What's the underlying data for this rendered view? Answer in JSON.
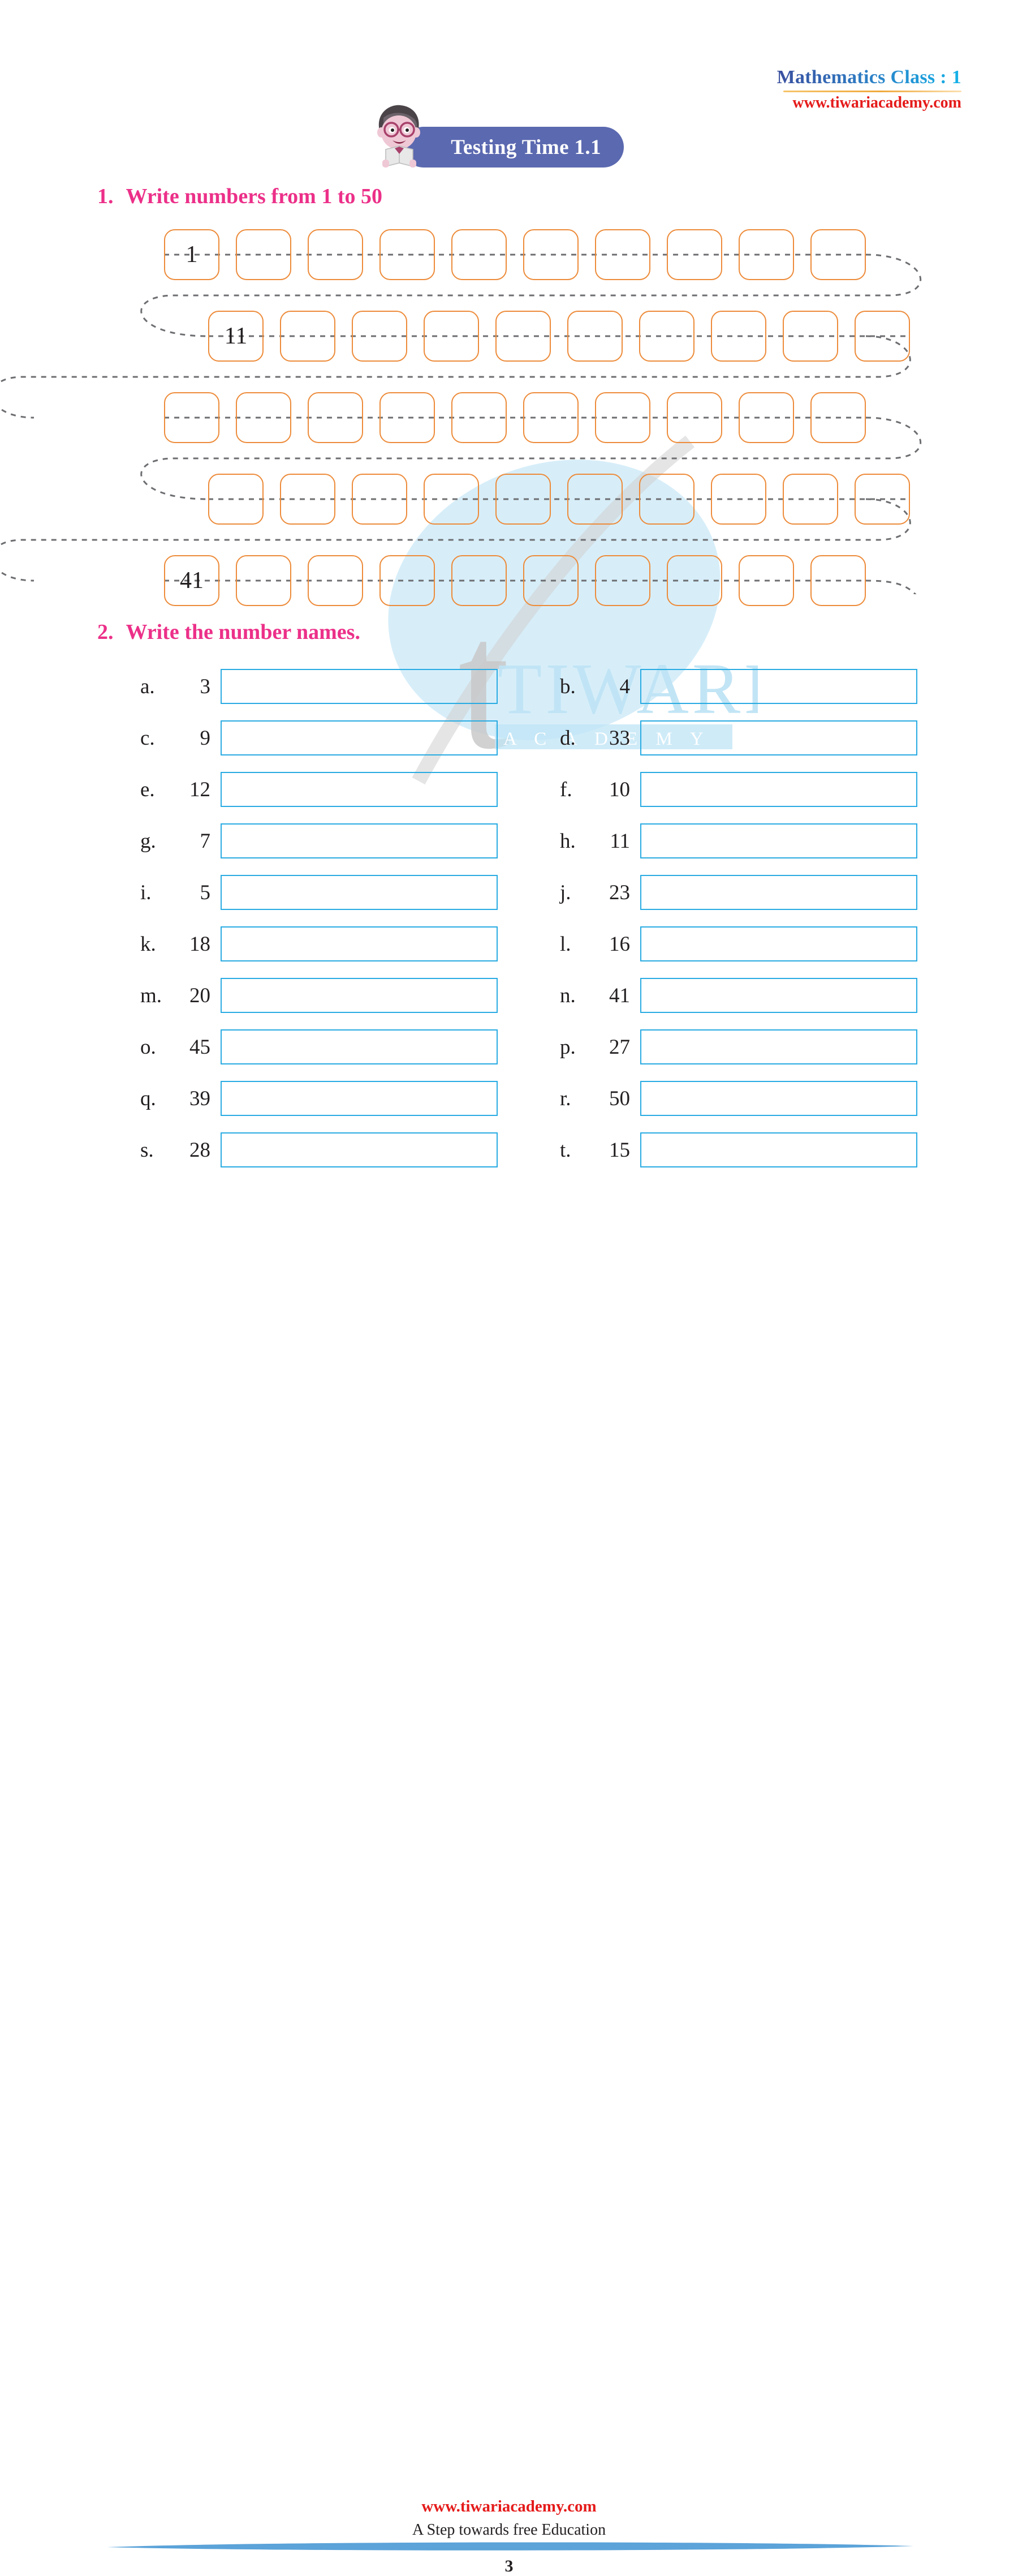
{
  "header": {
    "title": "Mathematics Class : 1",
    "website": "www.tiwariacademy.com"
  },
  "title_banner": {
    "label": "Testing Time 1.1",
    "icon": "boy-reading-book-icon"
  },
  "questions": [
    {
      "number": "1.",
      "text": "Write numbers from  1 to 50"
    },
    {
      "number": "2.",
      "text": "Write the number names."
    }
  ],
  "number_grid": {
    "rows": 5,
    "cols": 10,
    "filled": {
      "r0c0": "1",
      "r1c0": "11",
      "r4c0": "41"
    },
    "box_border_color": "#ED8B3A",
    "connector_color": "#6D6E71"
  },
  "number_names": {
    "box_border_color": "#29ABE2",
    "items": [
      {
        "label": "a.",
        "value": "3"
      },
      {
        "label": "b.",
        "value": "4"
      },
      {
        "label": "c.",
        "value": "9"
      },
      {
        "label": "d.",
        "value": "33"
      },
      {
        "label": "e.",
        "value": "12"
      },
      {
        "label": "f.",
        "value": "10"
      },
      {
        "label": "g.",
        "value": "7"
      },
      {
        "label": "h.",
        "value": "11"
      },
      {
        "label": "i.",
        "value": "5"
      },
      {
        "label": "j.",
        "value": "23"
      },
      {
        "label": "k.",
        "value": "18"
      },
      {
        "label": "l.",
        "value": "16"
      },
      {
        "label": "m.",
        "value": "20"
      },
      {
        "label": "n.",
        "value": "41"
      },
      {
        "label": "o.",
        "value": "45"
      },
      {
        "label": "p.",
        "value": "27"
      },
      {
        "label": "q.",
        "value": "39"
      },
      {
        "label": "r.",
        "value": "50"
      },
      {
        "label": "s.",
        "value": "28"
      },
      {
        "label": "t.",
        "value": "15"
      }
    ]
  },
  "watermark": {
    "brand": "TIWARI",
    "sub": "A C A D E M Y",
    "glyph": "t"
  },
  "footer": {
    "website": "www.tiwariacademy.com",
    "tagline": "A Step towards free Education",
    "page": "3"
  }
}
